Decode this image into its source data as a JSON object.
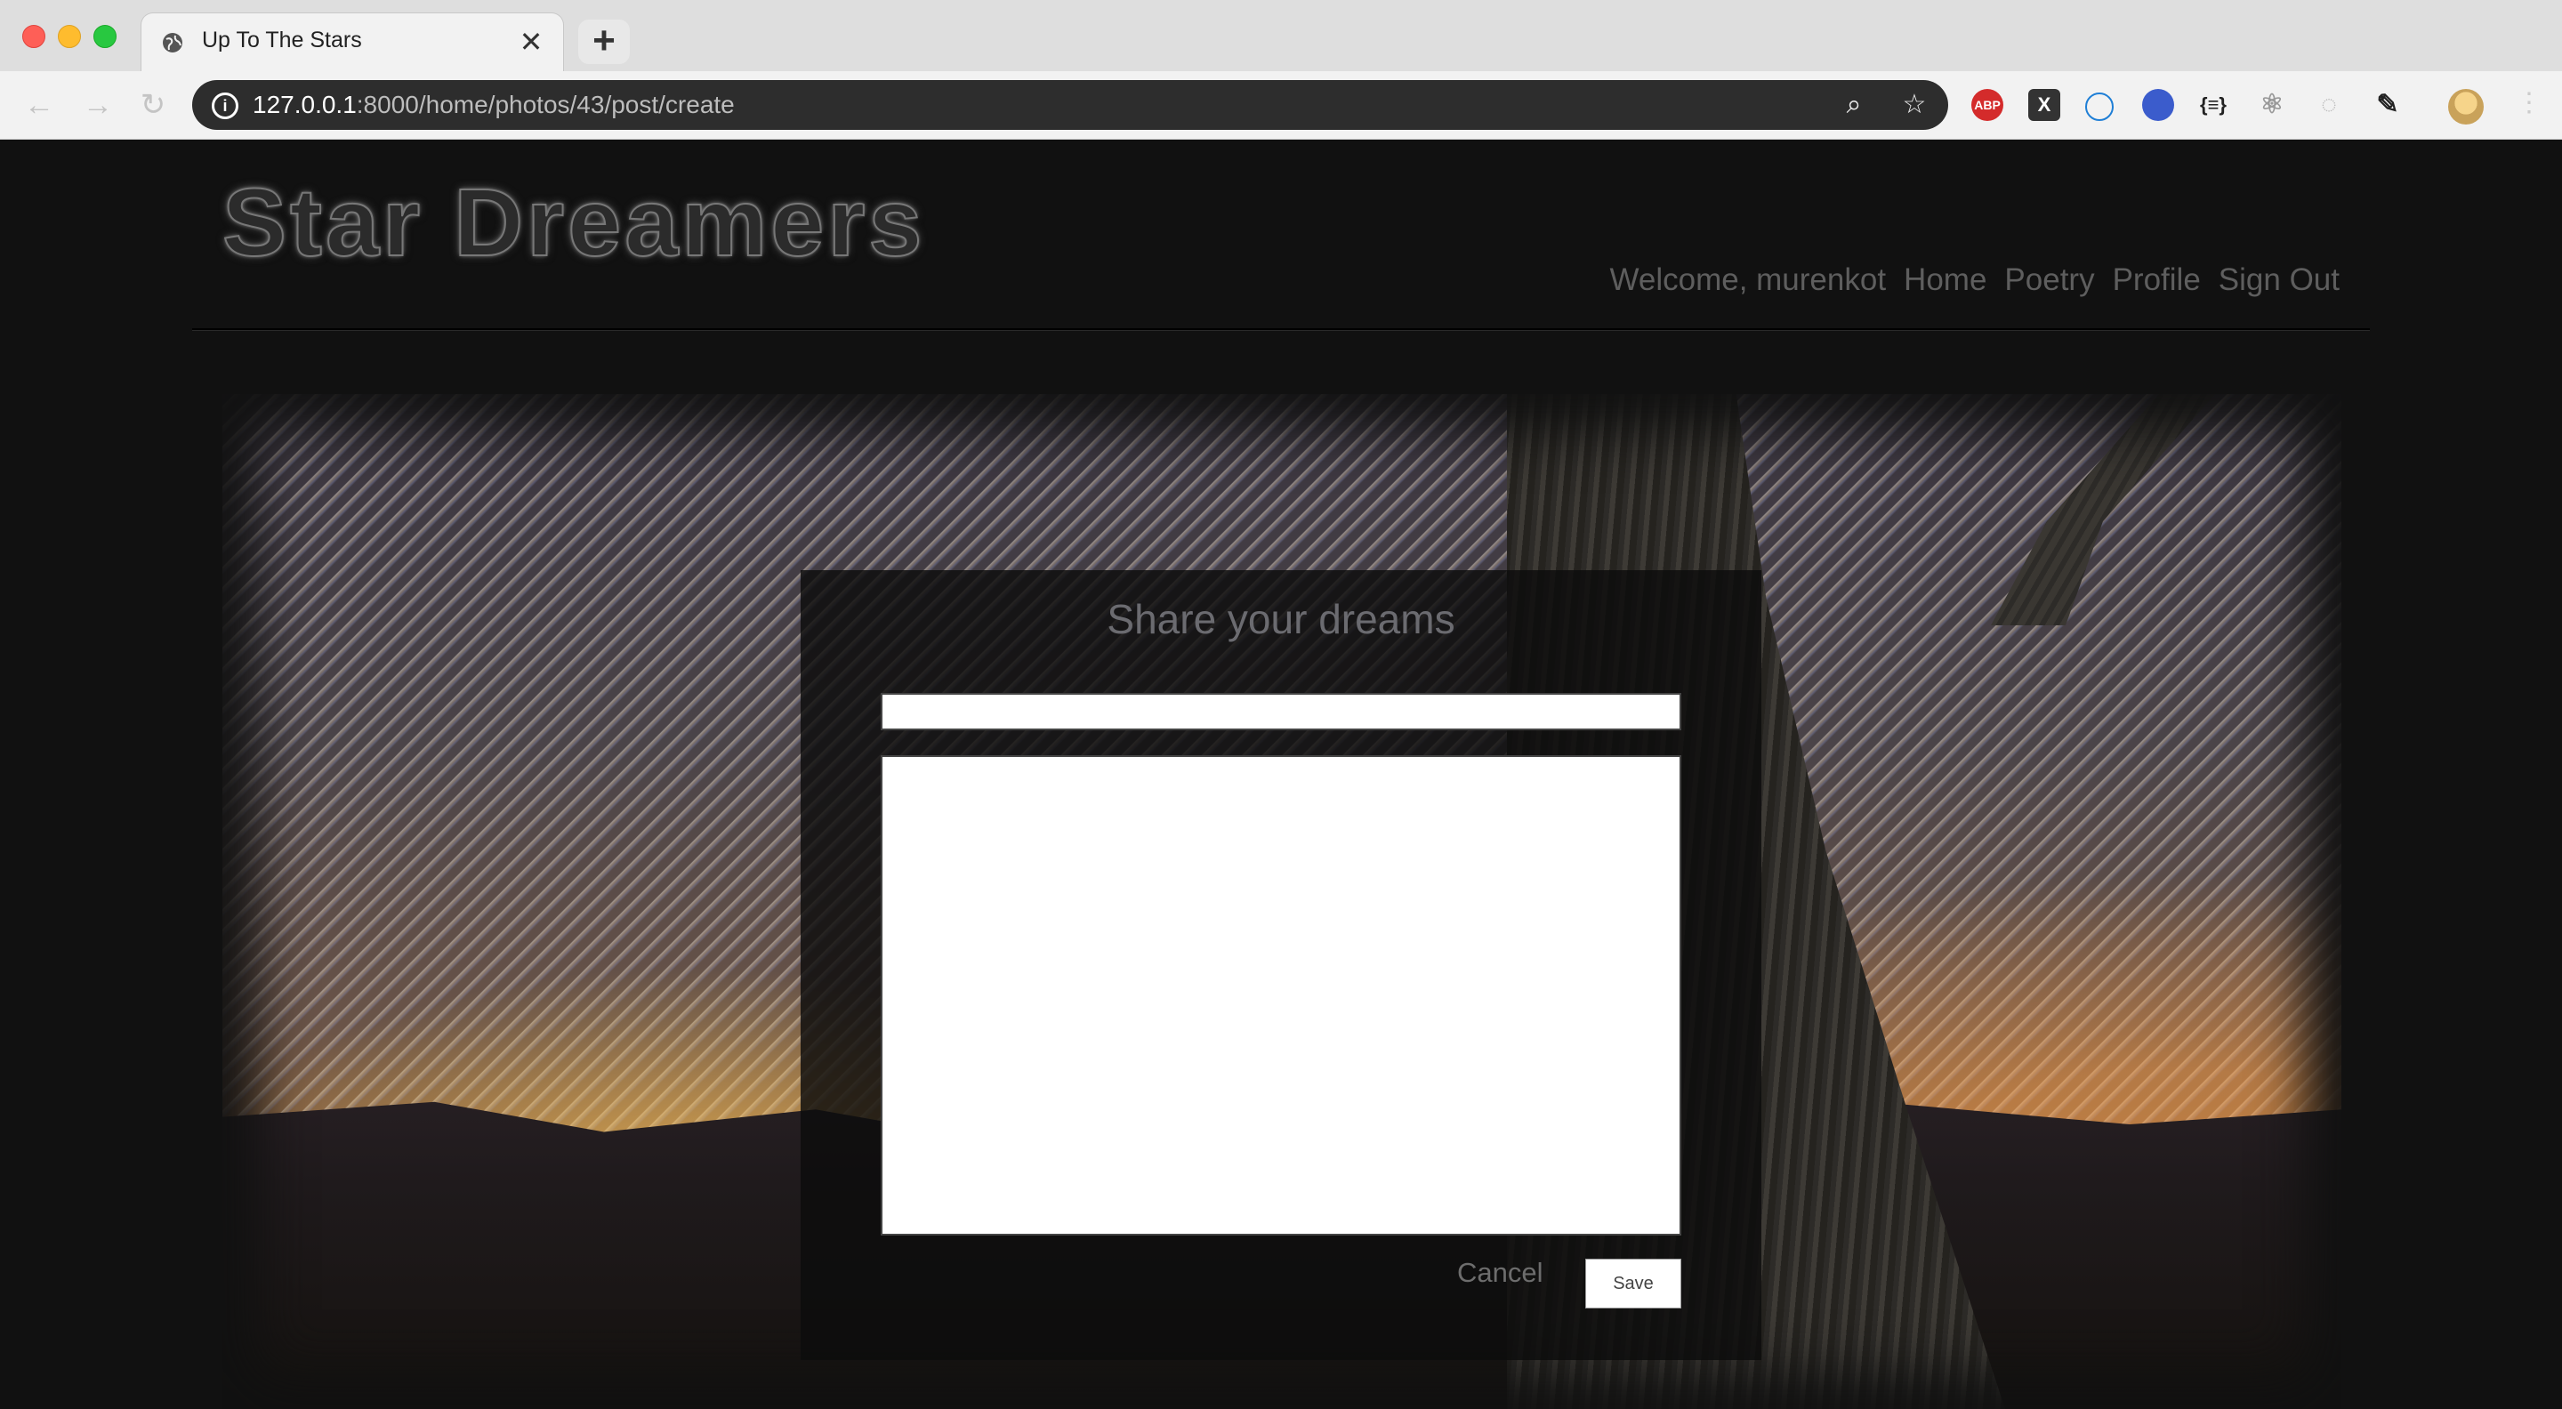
{
  "browser": {
    "tab_title": "Up To The Stars",
    "tab_close": "✕",
    "new_tab": "+",
    "url_host": "127.0.0.1",
    "url_path": ":8000/home/photos/43/post/create",
    "info_glyph": "i",
    "zoom_glyph": "⌕",
    "star_glyph": "☆",
    "back_glyph": "←",
    "forward_glyph": "→",
    "reload_glyph": "↻",
    "extensions": {
      "abp": "ABP",
      "x": "X",
      "json": "{≡}"
    },
    "menu_glyph": "⋮"
  },
  "site": {
    "logo": "Star Dreamers",
    "nav": {
      "welcome": "Welcome, murenkot",
      "home": "Home",
      "poetry": "Poetry",
      "profile": "Profile",
      "sign_out": "Sign Out"
    }
  },
  "form": {
    "title": "Share your dreams",
    "title_value": "",
    "body_value": "",
    "cancel_label": "Cancel",
    "save_label": "Save"
  }
}
